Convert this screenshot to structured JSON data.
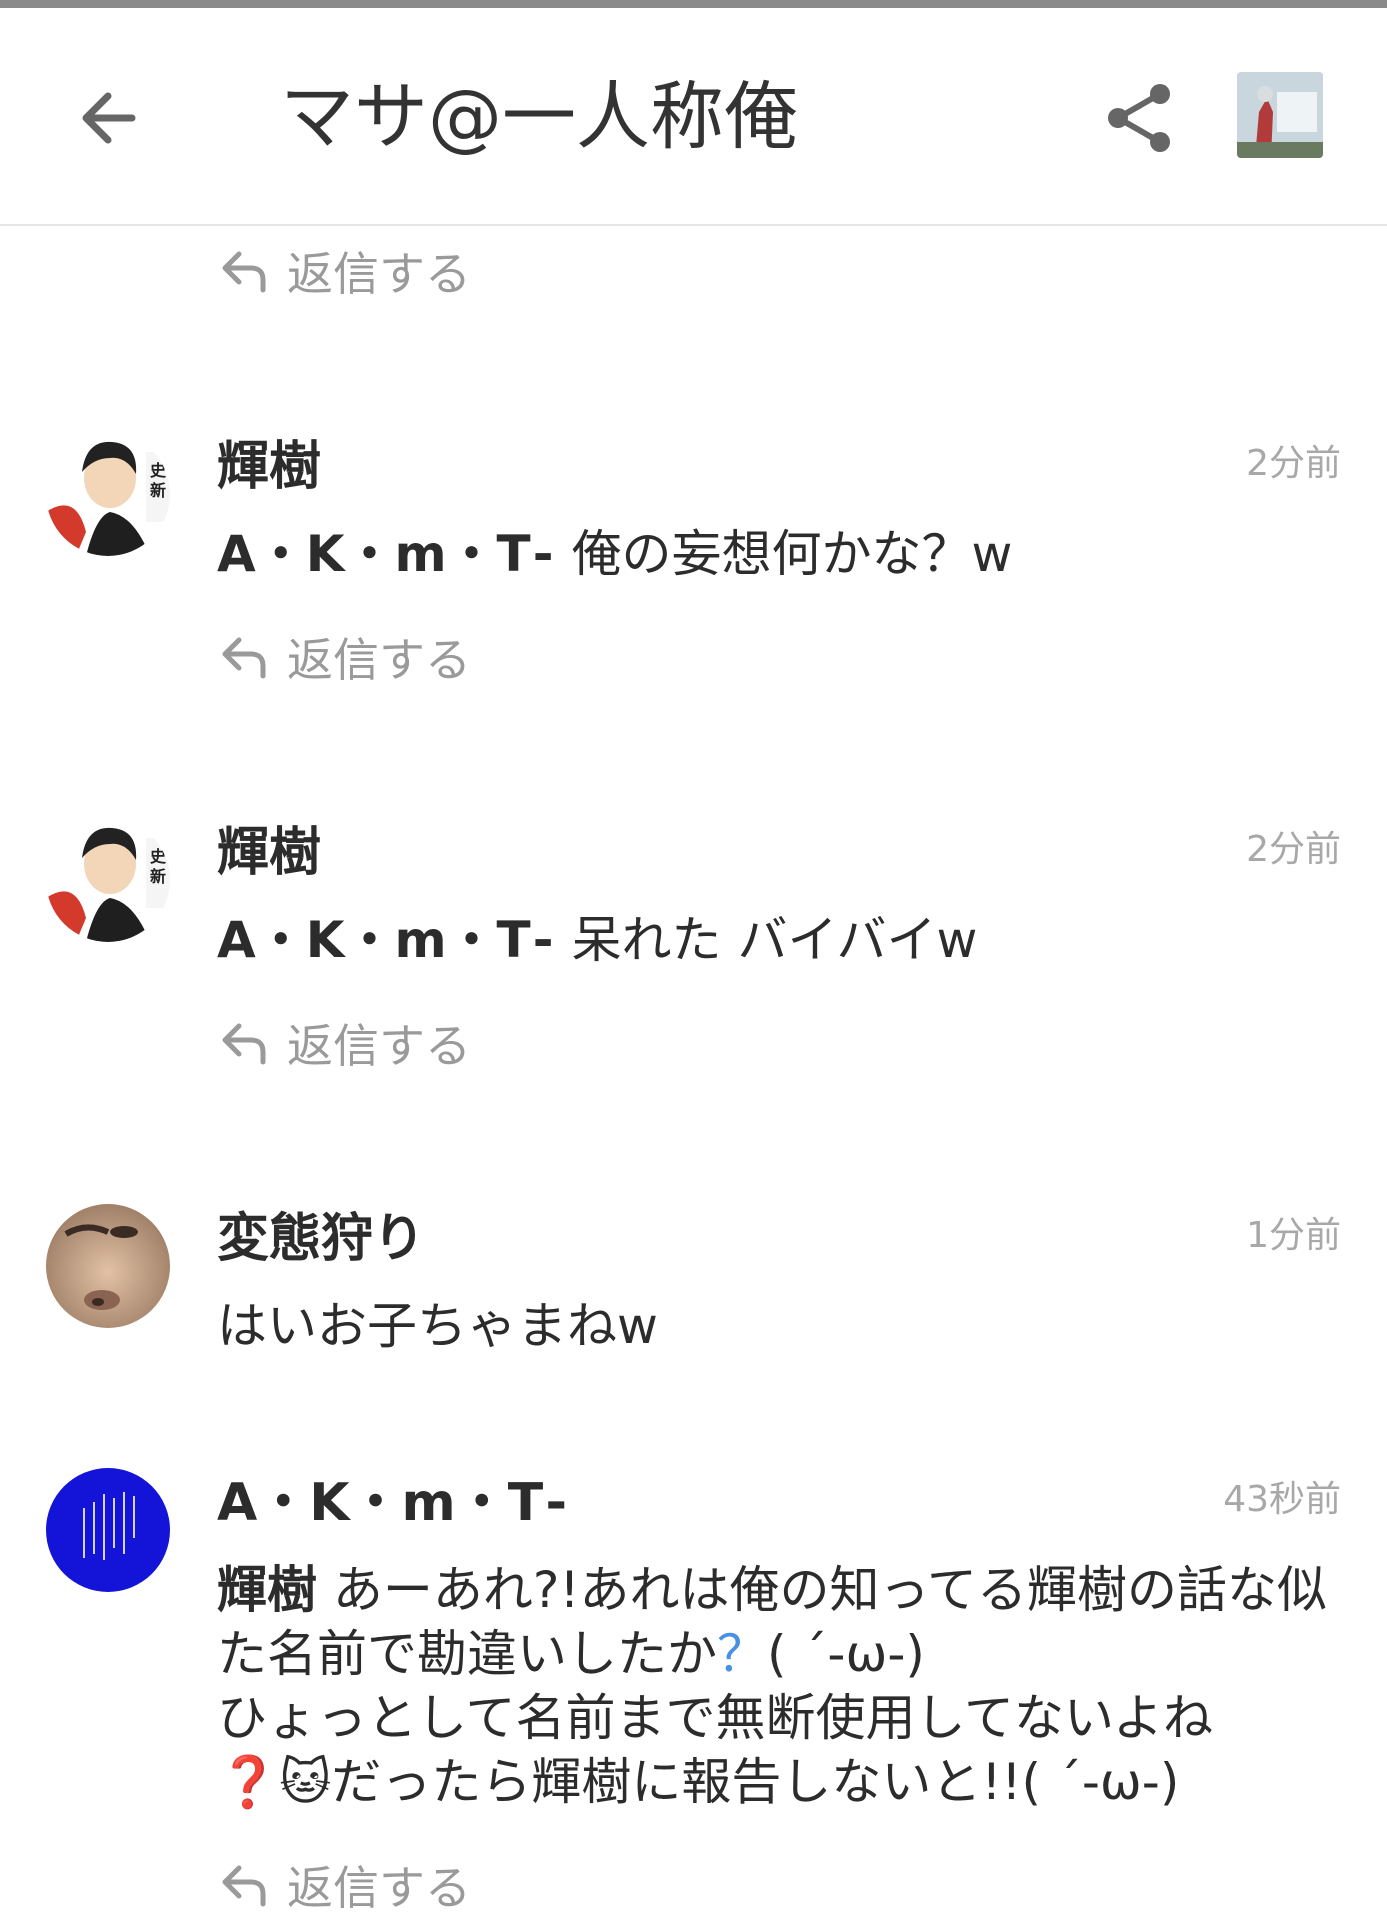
{
  "header": {
    "title": "マサ@一人称俺"
  },
  "reply_label": "返信する",
  "comments": [
    {
      "author": "輝樹",
      "time": "2分前",
      "mention": "A・K・m・T⁃",
      "text": "俺の妄想何かな？w"
    },
    {
      "author": "輝樹",
      "time": "2分前",
      "mention": "A・K・m・T⁃",
      "text": "呆れた バイバイw"
    },
    {
      "author": "変態狩り",
      "time": "1分前",
      "text": "はいお子ちゃまねw"
    },
    {
      "author": "A・K・m・T⁃",
      "time": "43秒前",
      "mention": "輝樹",
      "text_1": "あーあれ?!あれは俺の知ってる輝樹の話な似た名前で勘違いしたか",
      "q_blue": "？",
      "text_2": "( ´-ω-)",
      "text_3": "ひょっとして名前まで無断使用してないよね",
      "q_red": "❓",
      "cat_emoji": "🐱",
      "text_4": "だったら輝樹に報告しないと!!( ´-ω-)"
    }
  ],
  "avatars": [
    {
      "desc": "illustrated-man-with-text-icon"
    },
    {
      "desc": "illustrated-man-with-text-icon"
    },
    {
      "desc": "face-closeup-photo-icon"
    },
    {
      "desc": "blue-circle-poem-icon"
    }
  ]
}
